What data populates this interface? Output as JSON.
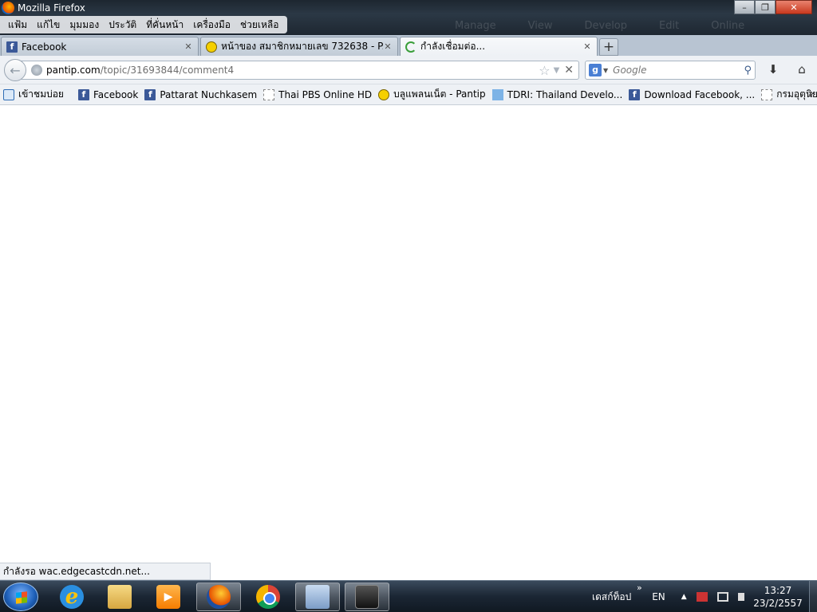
{
  "window": {
    "title": "Mozilla Firefox",
    "minimize": "–",
    "maximize": "❐",
    "close": "✕",
    "ghost_menu": [
      "Manage",
      "View",
      "Develop",
      "Edit",
      "Online"
    ]
  },
  "menu": {
    "items": [
      "แฟ้ม",
      "แก้ไข",
      "มุมมอง",
      "ประวัติ",
      "ที่คั่นหน้า",
      "เครื่องมือ",
      "ช่วยเหลือ"
    ]
  },
  "tabs": [
    {
      "label": "Facebook",
      "icon": "facebook-icon",
      "active": false
    },
    {
      "label": "หน้าของ สมาชิกหมายเลข 732638 - P...",
      "icon": "smiley-icon",
      "active": false
    },
    {
      "label": "กำลังเชื่อมต่อ...",
      "icon": "loading-spinner-icon",
      "active": true
    }
  ],
  "tab_close": "✕",
  "new_tab": "+",
  "nav": {
    "back": "←",
    "url_domain": "pantip.com",
    "url_path": "/topic/31693844/comment4",
    "star": "☆",
    "dropdown": "▼",
    "stop": "✕",
    "search_engine": "g",
    "search_placeholder": "Google",
    "search_glyph": "⚲",
    "download": "⬇",
    "home": "⌂"
  },
  "bookmarks": [
    {
      "label": "เข้าชมบ่อย",
      "icon": "search-bookmark-icon"
    },
    {
      "label": "Facebook",
      "icon": "facebook-icon"
    },
    {
      "label": "Pattarat Nuchkasem",
      "icon": "facebook-icon"
    },
    {
      "label": "Thai PBS Online HD",
      "icon": "blank-page-icon"
    },
    {
      "label": "บลูแพลนเน็ต - Pantip",
      "icon": "smiley-icon"
    },
    {
      "label": "TDRI: Thailand Develo...",
      "icon": "tdri-icon"
    },
    {
      "label": "Download Facebook, ...",
      "icon": "facebook-icon"
    },
    {
      "label": "กรมอุตุนิยมวิทยา",
      "icon": "blank-page-icon"
    }
  ],
  "bookmarks_more": "»",
  "status": {
    "text": "กำลังรอ wac.edgecastcdn.net..."
  },
  "taskbar": {
    "apps": [
      {
        "name": "internet-explorer",
        "active": false
      },
      {
        "name": "file-explorer",
        "active": false
      },
      {
        "name": "media-player",
        "active": false
      },
      {
        "name": "firefox",
        "active": true
      },
      {
        "name": "chrome",
        "active": false
      },
      {
        "name": "remote-desktop",
        "active": true
      },
      {
        "name": "camera-app",
        "active": true
      }
    ],
    "tray_chevron": "»",
    "desktop_label": "เดสก์ท็อป",
    "language": "EN",
    "tray_arrow": "▲",
    "time": "13:27",
    "date": "23/2/2557"
  }
}
